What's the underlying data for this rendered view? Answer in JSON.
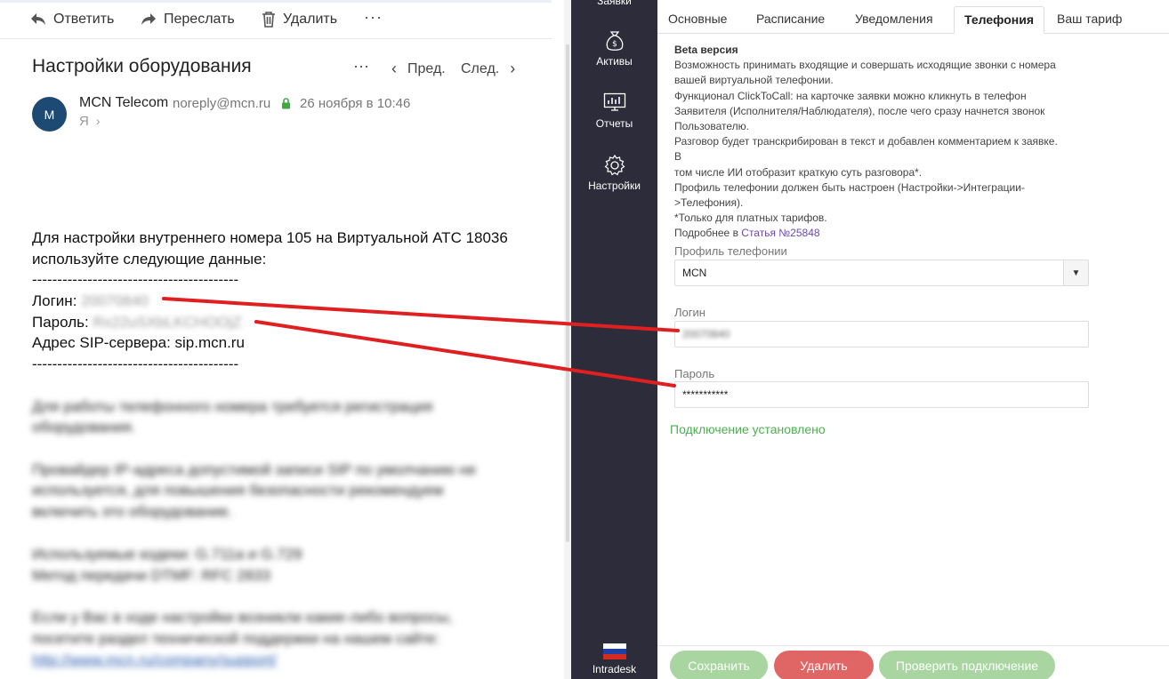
{
  "mail": {
    "toolbar": {
      "reply_label": "Ответить",
      "forward_label": "Переслать",
      "delete_label": "Удалить",
      "more_label": "···"
    },
    "subject": "Настройки оборудования",
    "subject_more_label": "···",
    "nav": {
      "prev_label": "Пред.",
      "next_label": "След."
    },
    "sender": {
      "avatar_letter": "M",
      "name": "MCN Telecom",
      "email": "noreply@mcn.ru",
      "date": "26 ноября в 10:46",
      "recipient": "Я"
    },
    "body": {
      "line1": "Для настройки внутреннего номера 105 на Виртуальной АТС 18036",
      "line2": "используйте следующие данные:",
      "separator": "-----------------------------------------",
      "login_label": "Логин:",
      "login_value": "20070840",
      "password_label": "Пароль:",
      "password_value": "Rx22uSXbLKCHOOjZ",
      "sip_line": "Адрес SIP-сервера: sip.mcn.ru",
      "blurred": [
        "Для работы телефонного номера требуется регистрация",
        "оборудования.",
        "Провайдер IP-адреса допустимой записи SIP по умолчанию не",
        "используется, для повышения безопасности рекомендуем",
        "включить это оборудование.",
        "Используемые кодеки: G.711a и G.729",
        "Метод передачи DTMF: RFC 2833",
        "Если у Вас в ходе настройки возникли какие-либо вопросы,",
        "посетите раздел технической поддержки на нашем сайте:",
        "http://www.mcn.ru/company/support/"
      ]
    }
  },
  "sidebar": {
    "items": [
      {
        "label": "Заявки",
        "icon": "requests-icon"
      },
      {
        "label": "Активы",
        "icon": "money-bag-icon"
      },
      {
        "label": "Отчеты",
        "icon": "chart-monitor-icon"
      },
      {
        "label": "Настройки",
        "icon": "gear-icon"
      }
    ],
    "brand": {
      "label": "Intradesk",
      "icon": "russia-flag-icon"
    }
  },
  "settings": {
    "tabs": [
      {
        "label": "Основные",
        "active": false
      },
      {
        "label": "Расписание",
        "active": false
      },
      {
        "label": "Уведомления",
        "active": false
      },
      {
        "label": "Телефония",
        "active": true
      },
      {
        "label": "Ваш тариф",
        "active": false
      }
    ],
    "description": {
      "beta": "Beta версия",
      "lines": [
        "Возможность принимать входящие и совершать исходящие звонки с номера",
        "вашей виртуальной телефонии.",
        "Функционал ClickToCall: на карточке заявки можно кликнуть в телефон",
        "Заявителя (Исполнителя/Наблюдателя), после чего сразу начнется звонок",
        "Пользователю.",
        "Разговор будет транскрибирован в текст и добавлен комментарием к заявке. В",
        "том числе ИИ отобразит краткую суть разговора*.",
        "Профиль телефонии должен быть настроен (Настройки->Интеграции-",
        ">Телефония).",
        "*Только для платных тарифов."
      ],
      "more_prefix": "Подробнее в ",
      "more_link": "Статья №25848"
    },
    "profile": {
      "label": "Профиль телефонии",
      "value": "MCN"
    },
    "login": {
      "label": "Логин",
      "value": "20070840"
    },
    "password": {
      "label": "Пароль",
      "value": "***********"
    },
    "status": "Подключение установлено",
    "buttons": {
      "save": "Сохранить",
      "delete": "Удалить",
      "check": "Проверить подключение"
    }
  },
  "colors": {
    "sidebar_bg": "#2d2c3a",
    "save_button": "#a8d5a0",
    "delete_button": "#e06666",
    "check_button": "#a8d5a0",
    "status_text": "#4caf50",
    "annotation_line": "#e02020"
  }
}
